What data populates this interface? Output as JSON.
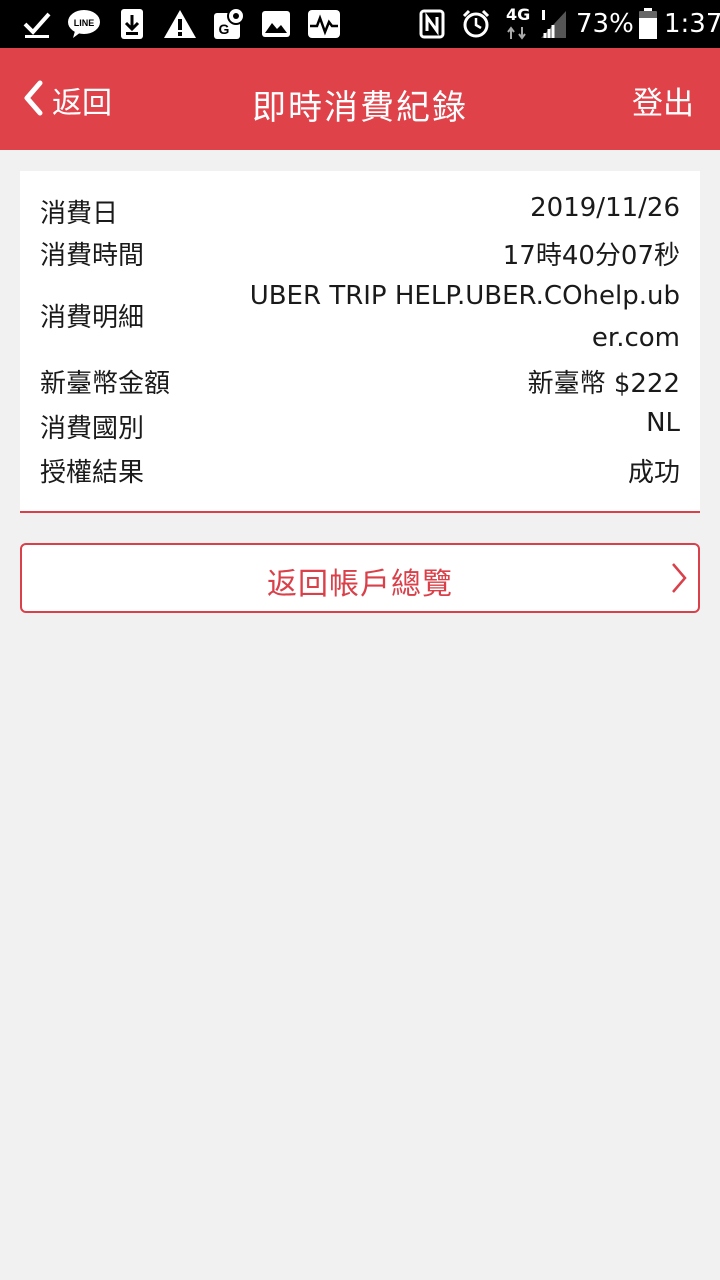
{
  "status_bar": {
    "battery_percent": "73%",
    "time": "1:37",
    "network": "4G"
  },
  "header": {
    "back_label": "返回",
    "title": "即時消費紀錄",
    "logout_label": "登出"
  },
  "details": [
    {
      "label": "消費日",
      "value": "2019/11/26"
    },
    {
      "label": "消費時間",
      "value": "17時40分07秒"
    },
    {
      "label": "消費明細",
      "value": "UBER TRIP HELP.UBER.COhelp.uber.com"
    },
    {
      "label": "新臺幣金額",
      "value": "新臺幣 $222"
    },
    {
      "label": "消費國別",
      "value": "NL"
    },
    {
      "label": "授權結果",
      "value": "成功"
    }
  ],
  "actions": {
    "return_label": "返回帳戶總覽"
  },
  "colors": {
    "accent": "#e0424a",
    "background": "#f1f1f1"
  }
}
